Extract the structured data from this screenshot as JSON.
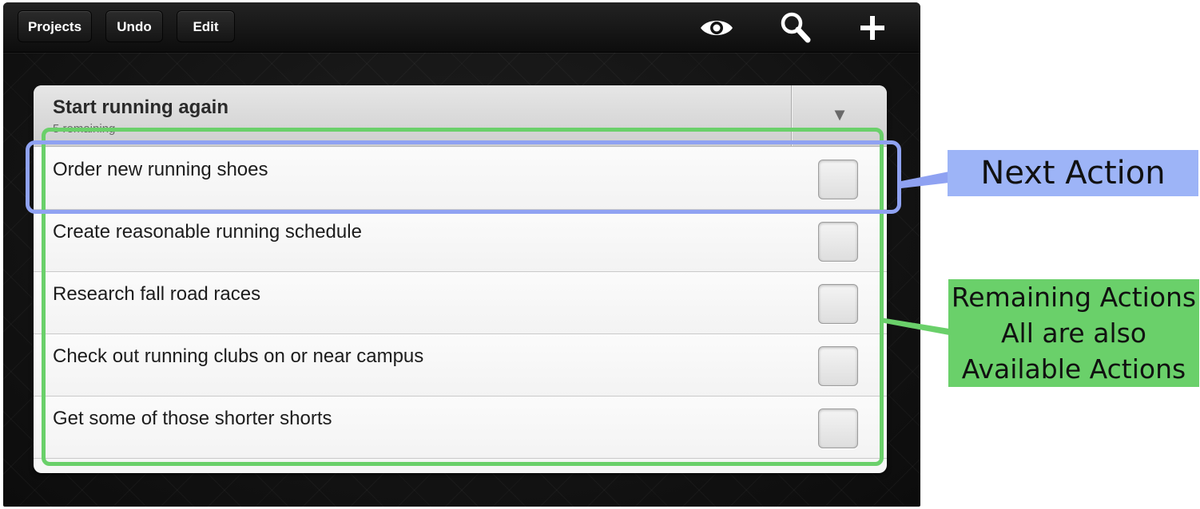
{
  "toolbar": {
    "projects_label": "Projects",
    "undo_label": "Undo",
    "edit_label": "Edit",
    "view_icon": "eye-icon",
    "search_icon": "search-icon",
    "add_icon": "plus-icon"
  },
  "project": {
    "title": "Start running again",
    "subtitle": "5 remaining",
    "collapse_glyph": "▼",
    "tasks": [
      {
        "label": "Order new running shoes",
        "completed": false
      },
      {
        "label": "Create reasonable running schedule",
        "completed": false
      },
      {
        "label": "Research fall road races",
        "completed": false
      },
      {
        "label": "Check out running clubs on or near campus",
        "completed": false
      },
      {
        "label": "Get some of those shorter shorts",
        "completed": false
      }
    ]
  },
  "annotations": {
    "next_action": "Next Action",
    "remaining_line1": "Remaining Actions",
    "remaining_line2": "All are also",
    "remaining_line3": "Available Actions"
  },
  "colors": {
    "next_action_highlight": "#8fa2f2",
    "next_action_callout": "#9db4f7",
    "remaining_highlight": "#6ad06a"
  }
}
